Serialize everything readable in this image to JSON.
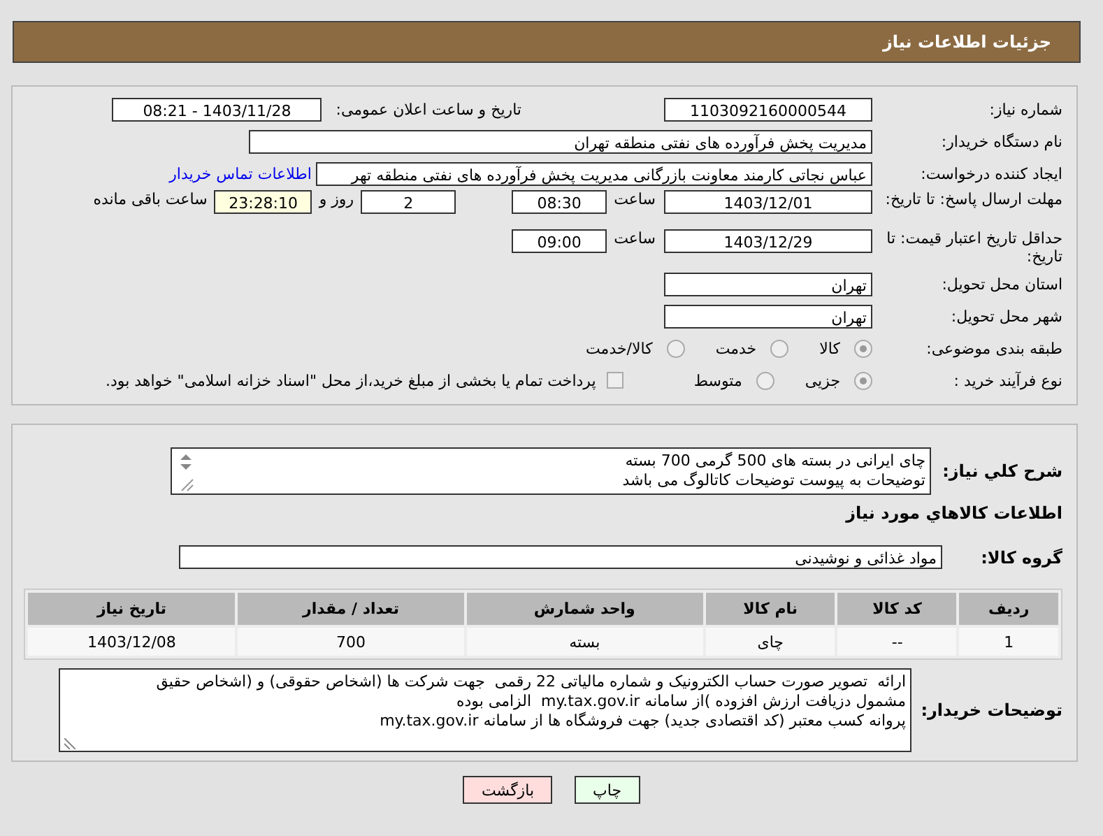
{
  "header": {
    "title": "جزئیات اطلاعات نیاز"
  },
  "need_number": {
    "label": "شماره نیاز:",
    "value": "1103092160000544"
  },
  "announce": {
    "label": "تاریخ و ساعت اعلان عمومی:",
    "value": "1403/11/28 - 08:21"
  },
  "buyer_org": {
    "label": "نام دستگاه خریدار:",
    "value": "مدیریت پخش فرآورده های نفتی منطقه تهران"
  },
  "requester": {
    "label": "ایجاد کننده درخواست:",
    "value": "عباس نجاتی کارمند معاونت بازرگانی مدیریت پخش فرآورده های نفتی منطقه تهر",
    "link": "اطلاعات تماس خریدار"
  },
  "reply_deadline": {
    "label": "مهلت ارسال پاسخ: تا تاریخ:",
    "date": "1403/12/01",
    "time_label": "ساعت",
    "time": "08:30",
    "days": "2",
    "days_label": "روز و",
    "remaining": "23:28:10",
    "remaining_label": "ساعت باقی مانده"
  },
  "price_validity": {
    "label": "حداقل تاریخ اعتبار قیمت: تا تاریخ:",
    "date": "1403/12/29",
    "time_label": "ساعت",
    "time": "09:00"
  },
  "province": {
    "label": "استان محل تحویل:",
    "value": "تهران"
  },
  "city": {
    "label": "شهر محل تحویل:",
    "value": "تهران"
  },
  "category": {
    "label": "طبقه بندی موضوعی:",
    "options": [
      {
        "label": "کالا",
        "selected": true
      },
      {
        "label": "خدمت",
        "selected": false
      },
      {
        "label": "کالا/خدمت",
        "selected": false
      }
    ]
  },
  "purchase_type": {
    "label": "نوع فرآیند خرید :",
    "options": [
      {
        "label": "جزیی",
        "selected": true
      },
      {
        "label": "متوسط",
        "selected": false
      }
    ],
    "payment": {
      "checked": false,
      "text": "پرداخت تمام یا بخشی از مبلغ خرید،از محل \"اسناد خزانه اسلامی\" خواهد بود."
    }
  },
  "description": {
    "label": "شرح کلي نياز:",
    "text": "چای ایرانی در بسته های 500 گرمی 700 بسته\nتوضیحات به پیوست توضیحات کاتالوگ می باشد"
  },
  "goods_title": "اطلاعات کالاهاي مورد نياز",
  "goods_group": {
    "label": "گروه کالا:",
    "value": "مواد غذائی و نوشیدنی"
  },
  "table": {
    "columns": [
      "ردیف",
      "کد کالا",
      "نام کالا",
      "واحد شمارش",
      "تعداد / مقدار",
      "تاریخ نیاز"
    ],
    "rows": [
      [
        "1",
        "--",
        "چای",
        "بسته",
        "700",
        "1403/12/08"
      ]
    ]
  },
  "buyer_notes": {
    "label": "توضیحات خریدار:",
    "text": "ارائه  تصویر صورت حساب الکترونیک و شماره مالیاتی 22 رقمی  جهت شرکت ها (اشخاص حقوقی) و (اشخاص حقیق\nمشمول دزیافت ارزش افزوده )از سامانه my.tax.gov.ir  الزامی بوده\nپروانه کسب معتبر (کد اقتصادی جدید) جهت فروشگاه ها از سامانه my.tax.gov.ir"
  },
  "buttons": [
    {
      "label": "چاپ",
      "kind": "print"
    },
    {
      "label": "بازگشت",
      "kind": "back"
    }
  ]
}
